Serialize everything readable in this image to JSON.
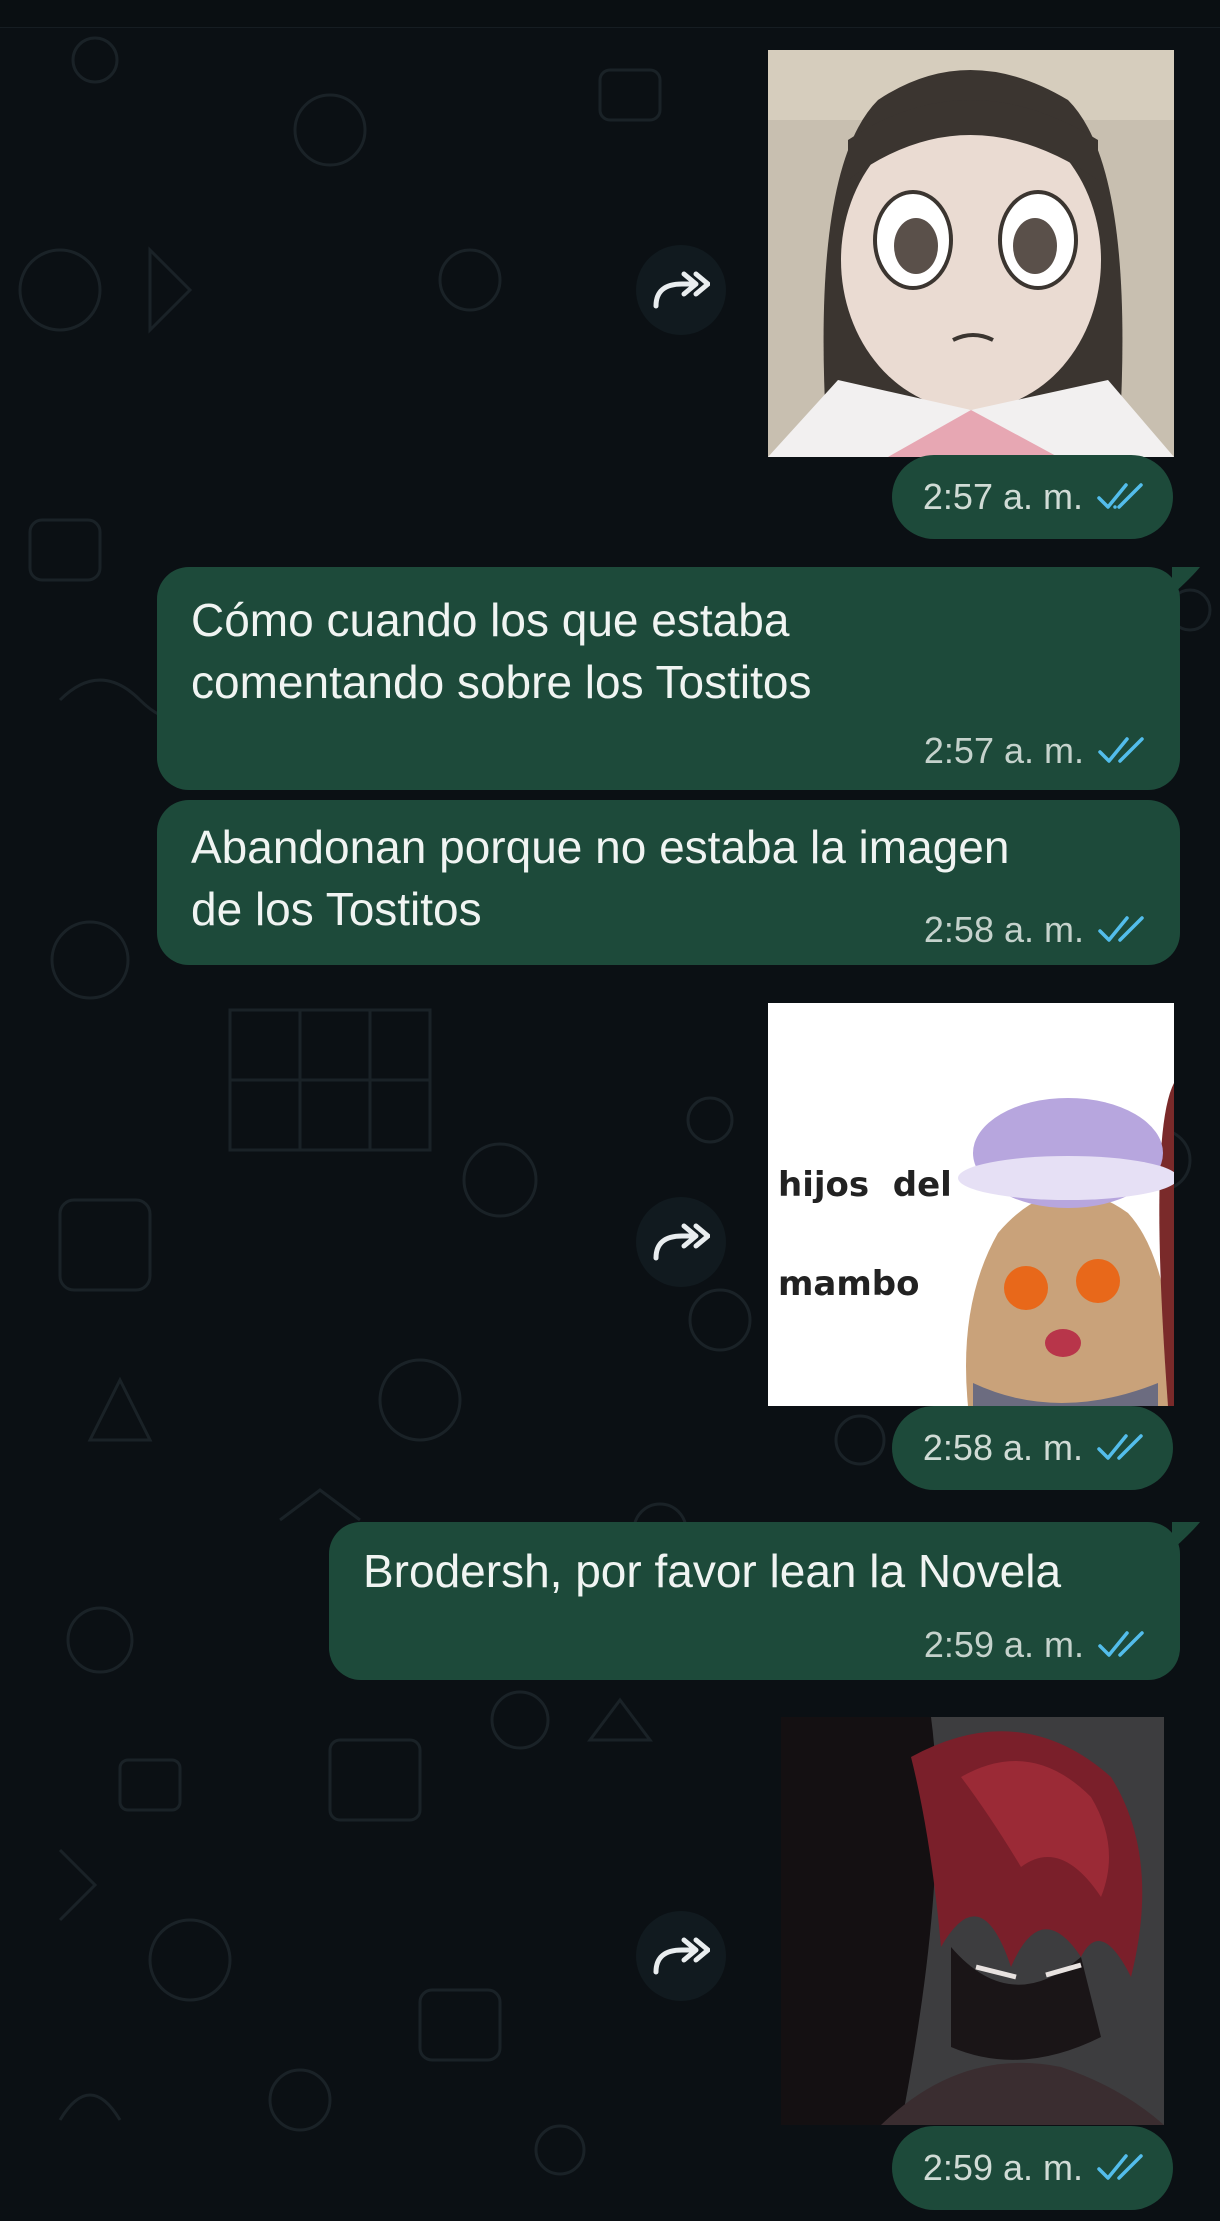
{
  "colors": {
    "background": "#0b1014",
    "bubble": "#1d4a3a",
    "read_ticks": "#53bdeb",
    "time_text": "#c5d2cc"
  },
  "messages": [
    {
      "type": "sticker",
      "image": "anime-girl-sticker",
      "time": "2:57 a. m.",
      "status": "read"
    },
    {
      "type": "text",
      "text": "Cómo cuando los que estaba\ncomentando sobre los Tostitos",
      "time": "2:57 a. m.",
      "status": "read"
    },
    {
      "type": "text",
      "text": "Abandonan porque no estaba la imagen\nde los Tostitos",
      "time": "2:58 a. m.",
      "status": "read"
    },
    {
      "type": "sticker",
      "image": "hijos-del-mambo-sticker",
      "caption_line1": "hijos  del",
      "caption_line2": "mambo",
      "time": "2:58 a. m.",
      "status": "read"
    },
    {
      "type": "text",
      "text": "Brodersh, por favor lean la Novela",
      "time": "2:59 a. m.",
      "status": "read"
    },
    {
      "type": "sticker",
      "image": "dark-red-hair-character-sticker",
      "time": "2:59 a. m.",
      "status": "read"
    }
  ],
  "icons": {
    "forward": "forward-icon",
    "read_receipt": "double-check-icon"
  }
}
